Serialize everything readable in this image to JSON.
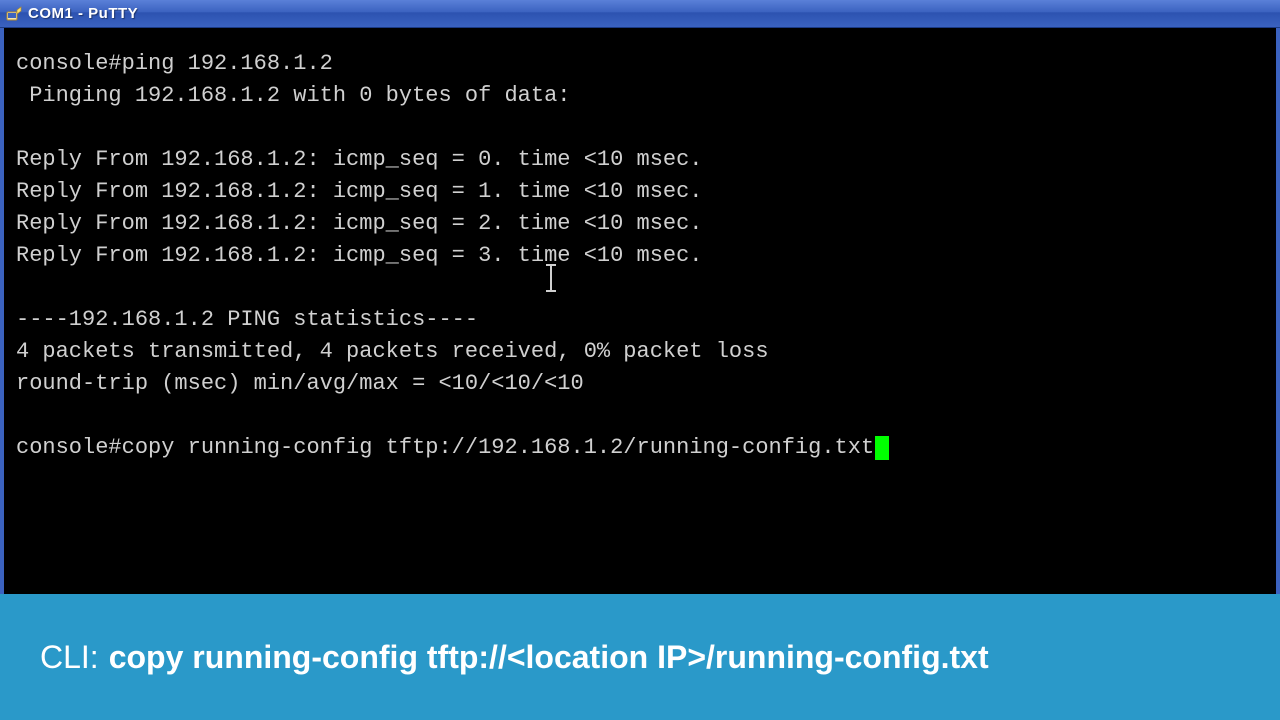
{
  "window": {
    "title": "COM1 - PuTTY",
    "icon": "putty-icon"
  },
  "terminal": {
    "lines": [
      "console#ping 192.168.1.2",
      " Pinging 192.168.1.2 with 0 bytes of data:",
      "",
      "Reply From 192.168.1.2: icmp_seq = 0. time <10 msec.",
      "Reply From 192.168.1.2: icmp_seq = 1. time <10 msec.",
      "Reply From 192.168.1.2: icmp_seq = 2. time <10 msec.",
      "Reply From 192.168.1.2: icmp_seq = 3. time <10 msec.",
      "",
      "----192.168.1.2 PING statistics----",
      "4 packets transmitted, 4 packets received, 0% packet loss",
      "round-trip (msec) min/avg/max = <10/<10/<10",
      ""
    ],
    "prompt": "console#",
    "current_command": "copy running-config tftp://192.168.1.2/running-config.txt"
  },
  "caption": {
    "prefix": "CLI:",
    "command": "copy running-config tftp://<location IP>/running-config.txt"
  },
  "colors": {
    "titlebar_gradient_top": "#5a80d8",
    "titlebar_gradient_bottom": "#2c52b0",
    "caption_bg": "#2a99c9",
    "terminal_fg": "#d0d0d0",
    "caret": "#00ff00"
  }
}
